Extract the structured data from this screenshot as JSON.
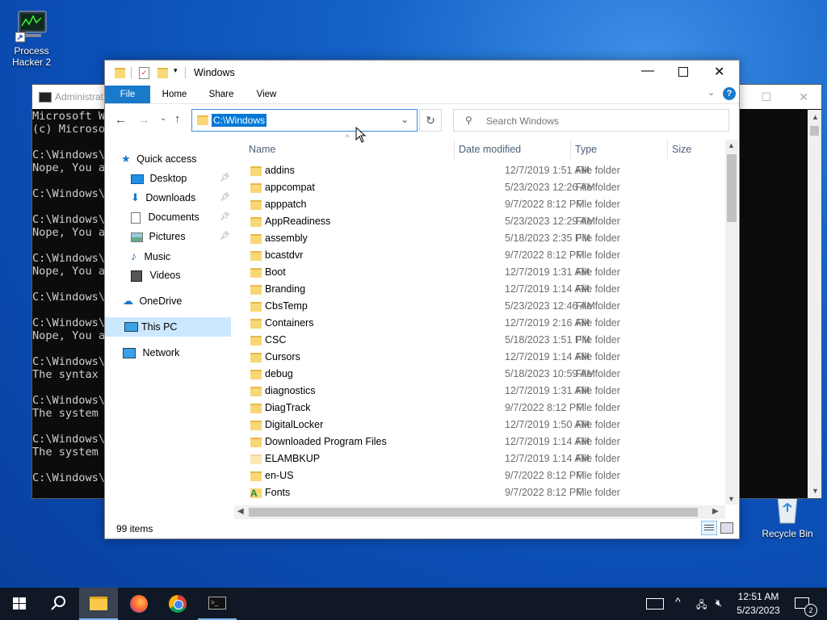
{
  "desktop": {
    "icons": [
      {
        "label": "Process Hacker 2"
      },
      {
        "label": "Recycle Bin"
      }
    ]
  },
  "cmd": {
    "title": "Administrat",
    "lines": [
      "Microsoft W",
      "(c) Microso",
      "",
      "C:\\Windows\\s",
      "Nope, You a",
      "",
      "C:\\Windows\\s",
      "",
      "C:\\Windows\\s",
      "Nope, You a",
      "",
      "C:\\Windows\\s",
      "Nope, You a",
      "",
      "C:\\Windows\\s",
      "",
      "C:\\Windows\\s",
      "Nope, You a",
      "",
      "C:\\Windows\\s",
      "The syntax ",
      "",
      "C:\\Windows\\s",
      "The system ",
      "",
      "C:\\Windows\\s",
      "The system ",
      "",
      "C:\\Windows\\s"
    ]
  },
  "explorer": {
    "title": "Windows",
    "tabs": [
      "File",
      "Home",
      "Share",
      "View"
    ],
    "address": "C:\\Windows",
    "search_placeholder": "Search Windows",
    "nav": {
      "quick_access": "Quick access",
      "quick_items": [
        "Desktop",
        "Downloads",
        "Documents",
        "Pictures",
        "Music",
        "Videos"
      ],
      "onedrive": "OneDrive",
      "this_pc": "This PC",
      "network": "Network"
    },
    "columns": {
      "name": "Name",
      "date": "Date modified",
      "type": "Type",
      "size": "Size"
    },
    "rows": [
      {
        "name": "addins",
        "date": "12/7/2019 1:51 AM",
        "type": "File folder"
      },
      {
        "name": "appcompat",
        "date": "5/23/2023 12:26 AM",
        "type": "File folder"
      },
      {
        "name": "apppatch",
        "date": "9/7/2022 8:12 PM",
        "type": "File folder"
      },
      {
        "name": "AppReadiness",
        "date": "5/23/2023 12:29 AM",
        "type": "File folder"
      },
      {
        "name": "assembly",
        "date": "5/18/2023 2:35 PM",
        "type": "File folder"
      },
      {
        "name": "bcastdvr",
        "date": "9/7/2022 8:12 PM",
        "type": "File folder"
      },
      {
        "name": "Boot",
        "date": "12/7/2019 1:31 AM",
        "type": "File folder"
      },
      {
        "name": "Branding",
        "date": "12/7/2019 1:14 AM",
        "type": "File folder"
      },
      {
        "name": "CbsTemp",
        "date": "5/23/2023 12:46 AM",
        "type": "File folder"
      },
      {
        "name": "Containers",
        "date": "12/7/2019 2:16 AM",
        "type": "File folder"
      },
      {
        "name": "CSC",
        "date": "5/18/2023 1:51 PM",
        "type": "File folder"
      },
      {
        "name": "Cursors",
        "date": "12/7/2019 1:14 AM",
        "type": "File folder"
      },
      {
        "name": "debug",
        "date": "5/18/2023 10:59 AM",
        "type": "File folder"
      },
      {
        "name": "diagnostics",
        "date": "12/7/2019 1:31 AM",
        "type": "File folder"
      },
      {
        "name": "DiagTrack",
        "date": "9/7/2022 8:12 PM",
        "type": "File folder"
      },
      {
        "name": "DigitalLocker",
        "date": "12/7/2019 1:50 AM",
        "type": "File folder"
      },
      {
        "name": "Downloaded Program Files",
        "date": "12/7/2019 1:14 AM",
        "type": "File folder"
      },
      {
        "name": "ELAMBKUP",
        "date": "12/7/2019 1:14 AM",
        "type": "File folder"
      },
      {
        "name": "en-US",
        "date": "9/7/2022 8:12 PM",
        "type": "File folder"
      },
      {
        "name": "Fonts",
        "date": "9/7/2022 8:12 PM",
        "type": "File folder"
      }
    ],
    "status": "99 items"
  },
  "taskbar": {
    "time": "12:51 AM",
    "date": "5/23/2023",
    "notifications": "2"
  },
  "colors": {
    "accent": "#0063b1",
    "selection": "#cce8ff",
    "taskbar": "#101826"
  }
}
